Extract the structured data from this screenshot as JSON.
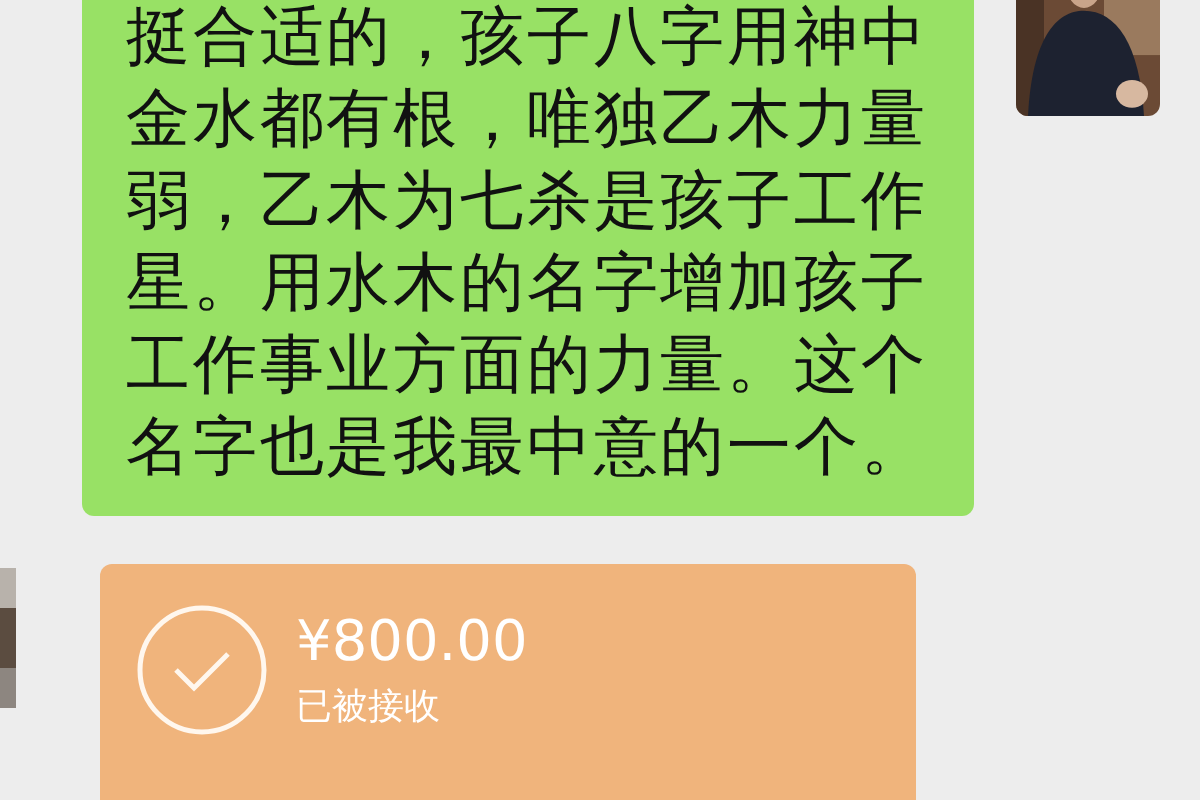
{
  "messages": [
    {
      "kind": "text",
      "text": "挺合适的，孩子八字用神中金水都有根，唯独乙木力量弱，乙木为七杀是孩子工作星。用水木的名字增加孩子工作事业方面的力量。这个名字也是我最中意的一个。"
    },
    {
      "kind": "transfer",
      "amount": "¥800.00",
      "status": "已被接收"
    }
  ]
}
